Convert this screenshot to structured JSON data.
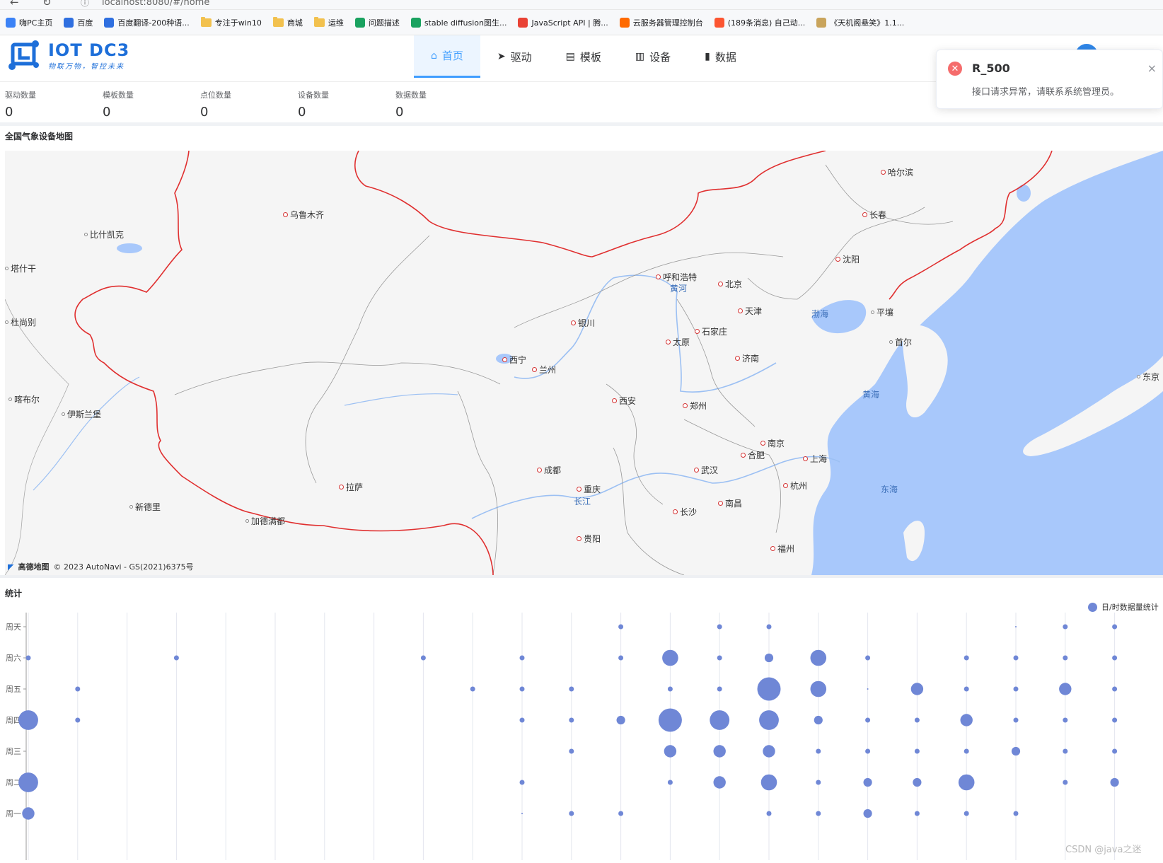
{
  "browser": {
    "url": "localhost:8080/#/home",
    "bookmarks": [
      {
        "label": "嗨PC主页",
        "icon": "pc-icon",
        "color": "#3b82f6"
      },
      {
        "label": "百度",
        "icon": "baidu-paw-icon",
        "color": "#2f6fe0"
      },
      {
        "label": "百度翻译-200种语...",
        "icon": "translate-icon",
        "color": "#2f6fe0"
      },
      {
        "label": "专注于win10",
        "icon": "folder-icon",
        "color": "#f2c14e"
      },
      {
        "label": "商城",
        "icon": "folder-icon",
        "color": "#f2c14e"
      },
      {
        "label": "运维",
        "icon": "folder-icon",
        "color": "#f2c14e"
      },
      {
        "label": "问题描述",
        "icon": "sheet-icon",
        "color": "#1aa260"
      },
      {
        "label": "stable diffusion图生...",
        "icon": "sheet-icon",
        "color": "#1aa260"
      },
      {
        "label": "JavaScript API | 腾...",
        "icon": "map-pin-icon",
        "color": "#e94235"
      },
      {
        "label": "云服务器管理控制台",
        "icon": "cloud-icon",
        "color": "#ff6a00"
      },
      {
        "label": "(189条消息) 自己动...",
        "icon": "csdn-icon",
        "color": "#fc5531"
      },
      {
        "label": "《天机阁悬笑》1.1...",
        "icon": "book-icon",
        "color": "#c9a45c"
      }
    ]
  },
  "app": {
    "title": "IOT DC3",
    "slogan": "物联万物，智控未来",
    "nav": [
      {
        "label": "首页",
        "icon": "home-icon",
        "glyph": "⌂",
        "active": true
      },
      {
        "label": "驱动",
        "icon": "send-icon",
        "glyph": "➤",
        "active": false
      },
      {
        "label": "模板",
        "icon": "document-icon",
        "glyph": "▤",
        "active": false
      },
      {
        "label": "设备",
        "icon": "device-icon",
        "glyph": "▥",
        "active": false
      },
      {
        "label": "数据",
        "icon": "bar-chart-icon",
        "glyph": "▮",
        "active": false
      }
    ]
  },
  "stats": [
    {
      "label": "驱动数量",
      "value": "0"
    },
    {
      "label": "模板数量",
      "value": "0"
    },
    {
      "label": "点位数量",
      "value": "0"
    },
    {
      "label": "设备数量",
      "value": "0"
    },
    {
      "label": "数据数量",
      "value": "0"
    }
  ],
  "map": {
    "title": "全国气象设备地图",
    "copyright_brand": "高德地图",
    "copyright": "© 2023 AutoNavi - GS(2021)6375号",
    "land_color": "#f5f5f5",
    "water_color": "#a8c8fb",
    "border_color": "#e03030",
    "cities": [
      {
        "name": "哈尔滨",
        "major": true
      },
      {
        "name": "长春",
        "major": true
      },
      {
        "name": "沈阳",
        "major": true
      },
      {
        "name": "乌鲁木齐",
        "major": true
      },
      {
        "name": "比什凯克",
        "major": false
      },
      {
        "name": "塔什干",
        "major": false
      },
      {
        "name": "杜尚别",
        "major": false
      },
      {
        "name": "呼和浩特",
        "major": true
      },
      {
        "name": "北京",
        "major": true
      },
      {
        "name": "天津",
        "major": true
      },
      {
        "name": "平壤",
        "major": false
      },
      {
        "name": "首尔",
        "major": false
      },
      {
        "name": "银川",
        "major": true
      },
      {
        "name": "石家庄",
        "major": true
      },
      {
        "name": "太原",
        "major": true
      },
      {
        "name": "济南",
        "major": true
      },
      {
        "name": "西宁",
        "major": true
      },
      {
        "name": "兰州",
        "major": true
      },
      {
        "name": "东京",
        "major": false
      },
      {
        "name": "喀布尔",
        "major": false
      },
      {
        "name": "伊斯兰堡",
        "major": false
      },
      {
        "name": "西安",
        "major": true
      },
      {
        "name": "郑州",
        "major": true
      },
      {
        "name": "南京",
        "major": true
      },
      {
        "name": "合肥",
        "major": true
      },
      {
        "name": "上海",
        "major": true
      },
      {
        "name": "成都",
        "major": true
      },
      {
        "name": "武汉",
        "major": true
      },
      {
        "name": "拉萨",
        "major": true
      },
      {
        "name": "重庆",
        "major": true
      },
      {
        "name": "杭州",
        "major": true
      },
      {
        "name": "新德里",
        "major": false
      },
      {
        "name": "长沙",
        "major": true
      },
      {
        "name": "南昌",
        "major": true
      },
      {
        "name": "加德满都",
        "major": false
      },
      {
        "name": "贵阳",
        "major": true
      },
      {
        "name": "福州",
        "major": true
      }
    ],
    "water_labels": [
      "黄河",
      "渤海",
      "黄海",
      "东海",
      "长江"
    ]
  },
  "chart_data": {
    "type": "scatter",
    "title": "统计",
    "legend": "日/时数据量统计",
    "legend_position": "top-right",
    "color": "#6f87d6",
    "y_categories": [
      "周一",
      "周二",
      "周三",
      "周四",
      "周五",
      "周六",
      "周天"
    ],
    "x_count": 24,
    "points": [
      {
        "x": 0,
        "y": "周一",
        "size": 3
      },
      {
        "x": 0,
        "y": "周二",
        "size": 5
      },
      {
        "x": 0,
        "y": "周四",
        "size": 5
      },
      {
        "x": 0,
        "y": "周六",
        "size": 1
      },
      {
        "x": 1,
        "y": "周四",
        "size": 1
      },
      {
        "x": 1,
        "y": "周五",
        "size": 1
      },
      {
        "x": 3,
        "y": "周六",
        "size": 1
      },
      {
        "x": 8,
        "y": "周六",
        "size": 1
      },
      {
        "x": 9,
        "y": "周五",
        "size": 1
      },
      {
        "x": 10,
        "y": "周一",
        "size": 0
      },
      {
        "x": 10,
        "y": "周二",
        "size": 1
      },
      {
        "x": 10,
        "y": "周四",
        "size": 1
      },
      {
        "x": 10,
        "y": "周五",
        "size": 1
      },
      {
        "x": 10,
        "y": "周六",
        "size": 1
      },
      {
        "x": 11,
        "y": "周一",
        "size": 1
      },
      {
        "x": 11,
        "y": "周三",
        "size": 1
      },
      {
        "x": 11,
        "y": "周四",
        "size": 1
      },
      {
        "x": 11,
        "y": "周五",
        "size": 1
      },
      {
        "x": 12,
        "y": "周一",
        "size": 1
      },
      {
        "x": 12,
        "y": "周四",
        "size": 2
      },
      {
        "x": 12,
        "y": "周六",
        "size": 1
      },
      {
        "x": 12,
        "y": "周天",
        "size": 1
      },
      {
        "x": 13,
        "y": "周二",
        "size": 1
      },
      {
        "x": 13,
        "y": "周三",
        "size": 3
      },
      {
        "x": 13,
        "y": "周四",
        "size": 6
      },
      {
        "x": 13,
        "y": "周五",
        "size": 1
      },
      {
        "x": 13,
        "y": "周六",
        "size": 4
      },
      {
        "x": 14,
        "y": "周二",
        "size": 3
      },
      {
        "x": 14,
        "y": "周三",
        "size": 3
      },
      {
        "x": 14,
        "y": "周四",
        "size": 5
      },
      {
        "x": 14,
        "y": "周五",
        "size": 1
      },
      {
        "x": 14,
        "y": "周六",
        "size": 1
      },
      {
        "x": 14,
        "y": "周天",
        "size": 1
      },
      {
        "x": 15,
        "y": "周一",
        "size": 1
      },
      {
        "x": 15,
        "y": "周二",
        "size": 4
      },
      {
        "x": 15,
        "y": "周三",
        "size": 3
      },
      {
        "x": 15,
        "y": "周四",
        "size": 5
      },
      {
        "x": 15,
        "y": "周五",
        "size": 6
      },
      {
        "x": 15,
        "y": "周六",
        "size": 2
      },
      {
        "x": 15,
        "y": "周天",
        "size": 1
      },
      {
        "x": 16,
        "y": "周一",
        "size": 1
      },
      {
        "x": 16,
        "y": "周二",
        "size": 1
      },
      {
        "x": 16,
        "y": "周三",
        "size": 1
      },
      {
        "x": 16,
        "y": "周四",
        "size": 2
      },
      {
        "x": 16,
        "y": "周五",
        "size": 4
      },
      {
        "x": 16,
        "y": "周六",
        "size": 4
      },
      {
        "x": 17,
        "y": "周一",
        "size": 2
      },
      {
        "x": 17,
        "y": "周二",
        "size": 2
      },
      {
        "x": 17,
        "y": "周三",
        "size": 1
      },
      {
        "x": 17,
        "y": "周四",
        "size": 1
      },
      {
        "x": 17,
        "y": "周五",
        "size": 0
      },
      {
        "x": 17,
        "y": "周六",
        "size": 1
      },
      {
        "x": 18,
        "y": "周一",
        "size": 1
      },
      {
        "x": 18,
        "y": "周二",
        "size": 2
      },
      {
        "x": 18,
        "y": "周三",
        "size": 1
      },
      {
        "x": 18,
        "y": "周四",
        "size": 1
      },
      {
        "x": 18,
        "y": "周五",
        "size": 3
      },
      {
        "x": 19,
        "y": "周一",
        "size": 1
      },
      {
        "x": 19,
        "y": "周二",
        "size": 4
      },
      {
        "x": 19,
        "y": "周三",
        "size": 1
      },
      {
        "x": 19,
        "y": "周四",
        "size": 3
      },
      {
        "x": 19,
        "y": "周五",
        "size": 1
      },
      {
        "x": 19,
        "y": "周六",
        "size": 1
      },
      {
        "x": 20,
        "y": "周一",
        "size": 1
      },
      {
        "x": 20,
        "y": "周三",
        "size": 2
      },
      {
        "x": 20,
        "y": "周四",
        "size": 1
      },
      {
        "x": 20,
        "y": "周五",
        "size": 1
      },
      {
        "x": 20,
        "y": "周六",
        "size": 1
      },
      {
        "x": 20,
        "y": "周天",
        "size": 0
      },
      {
        "x": 21,
        "y": "周二",
        "size": 1
      },
      {
        "x": 21,
        "y": "周三",
        "size": 1
      },
      {
        "x": 21,
        "y": "周四",
        "size": 1
      },
      {
        "x": 21,
        "y": "周五",
        "size": 3
      },
      {
        "x": 21,
        "y": "周六",
        "size": 1
      },
      {
        "x": 21,
        "y": "周天",
        "size": 1
      },
      {
        "x": 22,
        "y": "周二",
        "size": 2
      },
      {
        "x": 22,
        "y": "周三",
        "size": 1
      },
      {
        "x": 22,
        "y": "周四",
        "size": 1
      },
      {
        "x": 22,
        "y": "周五",
        "size": 1
      },
      {
        "x": 22,
        "y": "周六",
        "size": 1
      },
      {
        "x": 22,
        "y": "周天",
        "size": 1
      }
    ]
  },
  "toast": {
    "title": "R_500",
    "message": "接口请求异常，请联系系统管理员。",
    "close": "×"
  },
  "watermark": "CSDN @java之迷"
}
